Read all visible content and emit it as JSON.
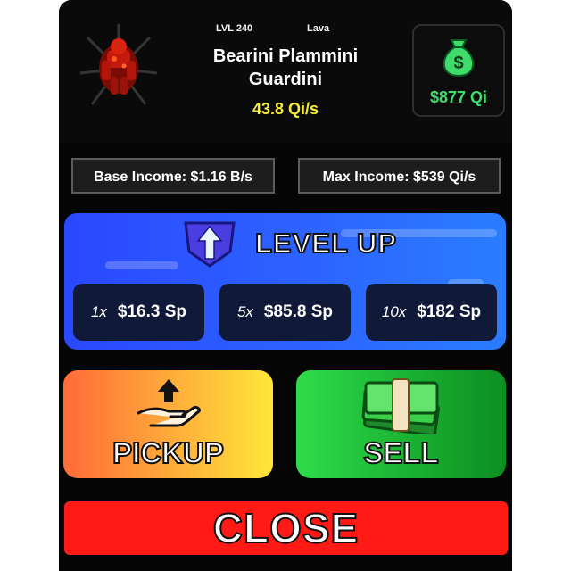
{
  "unit": {
    "level": "LVL 240",
    "element": "Lava",
    "name": "Bearini Plammini Guardini",
    "rate": "43.8 Qi/s"
  },
  "wallet": {
    "amount": "$877 Qi",
    "icon": "money-bag-icon"
  },
  "stats": {
    "base_income": "Base Income: $1.16 B/s",
    "max_income": "Max Income: $539 Qi/s"
  },
  "level_up": {
    "title": "LEVEL UP",
    "icon": "up-arrow-shield-icon",
    "options": [
      {
        "multiplier": "1x",
        "price": "$16.3 Sp"
      },
      {
        "multiplier": "5x",
        "price": "$85.8 Sp"
      },
      {
        "multiplier": "10x",
        "price": "$182 Sp"
      }
    ]
  },
  "actions": {
    "pickup_label": "PICKUP",
    "pickup_icon": "hand-arrow-up-icon",
    "sell_label": "SELL",
    "sell_icon": "cash-stack-icon",
    "close_label": "CLOSE"
  },
  "colors": {
    "panel": "#050505",
    "rate": "#f5ec35",
    "money": "#3fdc6b",
    "level_up_bg": "#2d60ff",
    "pickup_bg": "#ffb03a",
    "sell_bg": "#17ad2f",
    "close_bg": "#ff1a16"
  }
}
